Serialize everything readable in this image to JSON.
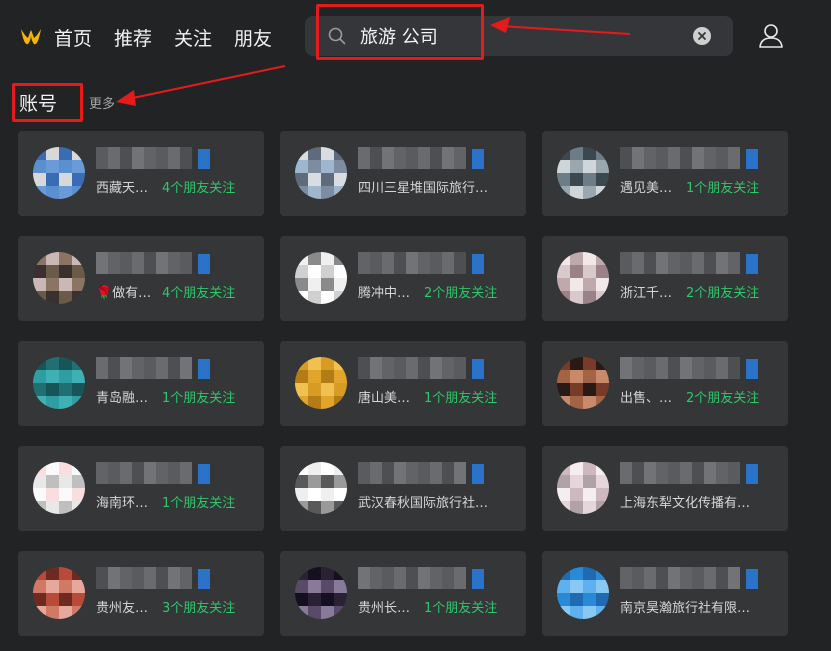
{
  "nav": {
    "items": [
      "首页",
      "推荐",
      "关注",
      "朋友"
    ]
  },
  "search": {
    "value": "旅游 公司"
  },
  "section": {
    "title": "账号",
    "more": "更多"
  },
  "colors": {
    "friends_green": "#2cc86a",
    "highlight_red": "#e61a1a",
    "logo_orange": "#f7b500",
    "verified_blue": "#2a73c8"
  },
  "accounts": [
    {
      "desc": "西藏天…",
      "friends": "4个朋友关注"
    },
    {
      "desc": "四川三星堆国际旅行…",
      "friends": ""
    },
    {
      "desc": "遇见美…",
      "friends": "1个朋友关注"
    },
    {
      "desc": "🌹做有…",
      "friends": "4个朋友关注"
    },
    {
      "desc": "腾冲中…",
      "friends": "2个朋友关注"
    },
    {
      "desc": "浙江千…",
      "friends": "2个朋友关注"
    },
    {
      "desc": "青岛融…",
      "friends": "1个朋友关注"
    },
    {
      "desc": "唐山美…",
      "friends": "1个朋友关注"
    },
    {
      "desc": "出售、…",
      "friends": "2个朋友关注"
    },
    {
      "desc": "海南环…",
      "friends": "1个朋友关注"
    },
    {
      "desc": "武汉春秋国际旅行社…",
      "friends": ""
    },
    {
      "desc": "上海东犁文化传播有…",
      "friends": ""
    },
    {
      "desc": "贵州友…",
      "friends": "3个朋友关注"
    },
    {
      "desc": "贵州长…",
      "friends": "1个朋友关注"
    },
    {
      "desc": "南京昊瀚旅行社有限…",
      "friends": ""
    }
  ]
}
